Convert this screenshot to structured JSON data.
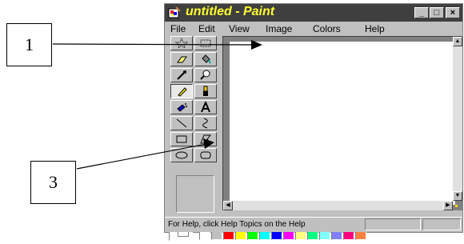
{
  "window": {
    "title": "untitled - Paint",
    "min_label": "_",
    "max_label": "□",
    "close_label": "×"
  },
  "menu": [
    "File",
    "Edit",
    "View",
    "Image",
    "Colors",
    "Help"
  ],
  "tools": [
    {
      "name": "free-form-select",
      "icon": "star-select-icon"
    },
    {
      "name": "select",
      "icon": "rect-select-icon"
    },
    {
      "name": "eraser",
      "icon": "eraser-icon"
    },
    {
      "name": "fill",
      "icon": "fill-bucket-icon"
    },
    {
      "name": "pick-color",
      "icon": "eyedropper-icon"
    },
    {
      "name": "magnifier",
      "icon": "magnifier-icon"
    },
    {
      "name": "pencil",
      "icon": "pencil-icon"
    },
    {
      "name": "brush",
      "icon": "brush-icon"
    },
    {
      "name": "airbrush",
      "icon": "airbrush-icon"
    },
    {
      "name": "text",
      "icon": "text-icon"
    },
    {
      "name": "line",
      "icon": "line-icon"
    },
    {
      "name": "curve",
      "icon": "curve-icon"
    },
    {
      "name": "rectangle",
      "icon": "rectangle-icon"
    },
    {
      "name": "polygon",
      "icon": "polygon-icon"
    },
    {
      "name": "ellipse",
      "icon": "ellipse-icon"
    },
    {
      "name": "rounded-rectangle",
      "icon": "rounded-rectangle-icon"
    }
  ],
  "active_tool": "pencil",
  "palette": {
    "foreground": "#000000",
    "background": "#ffffff",
    "row1": [
      "#000000",
      "#808080",
      "#800000",
      "#808000",
      "#008000",
      "#008080",
      "#000080",
      "#800080",
      "#808040",
      "#004040",
      "#0080ff",
      "#004080",
      "#8000ff",
      "#804000"
    ],
    "row2": [
      "#ffffff",
      "#c0c0c0",
      "#ff0000",
      "#ffff00",
      "#00ff00",
      "#00ffff",
      "#0000ff",
      "#ff00ff",
      "#ffff80",
      "#00ff80",
      "#80ffff",
      "#8080ff",
      "#ff0080",
      "#ff8040"
    ]
  },
  "status": {
    "text": "For Help, click Help Topics on the Help"
  },
  "callouts": {
    "one": "1",
    "three": "3"
  }
}
